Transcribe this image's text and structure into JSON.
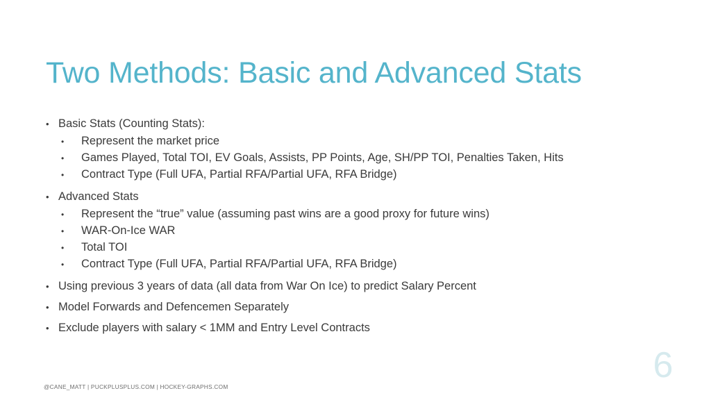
{
  "slide": {
    "title": "Two Methods: Basic and Advanced Stats",
    "page_number": "6",
    "footer": "@CANE_MATT | PUCKPLUSPLUS.COM | HOCKEY-GRAPHS.COM",
    "colors": {
      "title": "#54B4CB",
      "body_text": "#3A3A3A",
      "page_number": "#D6EAEE",
      "footer_text": "#6E6E6E",
      "background": "#FFFFFF"
    },
    "bullet_marker": "•",
    "content": [
      {
        "level": 1,
        "text": "Basic Stats (Counting Stats):"
      },
      {
        "level": 2,
        "text": "Represent the market price"
      },
      {
        "level": 2,
        "text": "Games Played, Total TOI, EV Goals, Assists, PP Points, Age, SH/PP TOI, Penalties Taken, Hits"
      },
      {
        "level": 2,
        "text": "Contract Type (Full UFA, Partial RFA/Partial UFA, RFA Bridge)"
      },
      {
        "level": 1,
        "text": "Advanced Stats"
      },
      {
        "level": 2,
        "text": "Represent the “true” value (assuming past wins are a good proxy for future wins)"
      },
      {
        "level": 2,
        "text": "WAR-On-Ice WAR"
      },
      {
        "level": 2,
        "text": "Total TOI"
      },
      {
        "level": 2,
        "text": "Contract Type (Full UFA, Partial RFA/Partial UFA, RFA Bridge)"
      },
      {
        "level": 1,
        "text": "Using previous 3 years of data (all data from War On Ice) to predict Salary Percent"
      },
      {
        "level": 1,
        "text": "Model Forwards and Defencemen Separately"
      },
      {
        "level": 1,
        "text": "Exclude players with salary < 1MM and Entry Level Contracts"
      }
    ]
  }
}
